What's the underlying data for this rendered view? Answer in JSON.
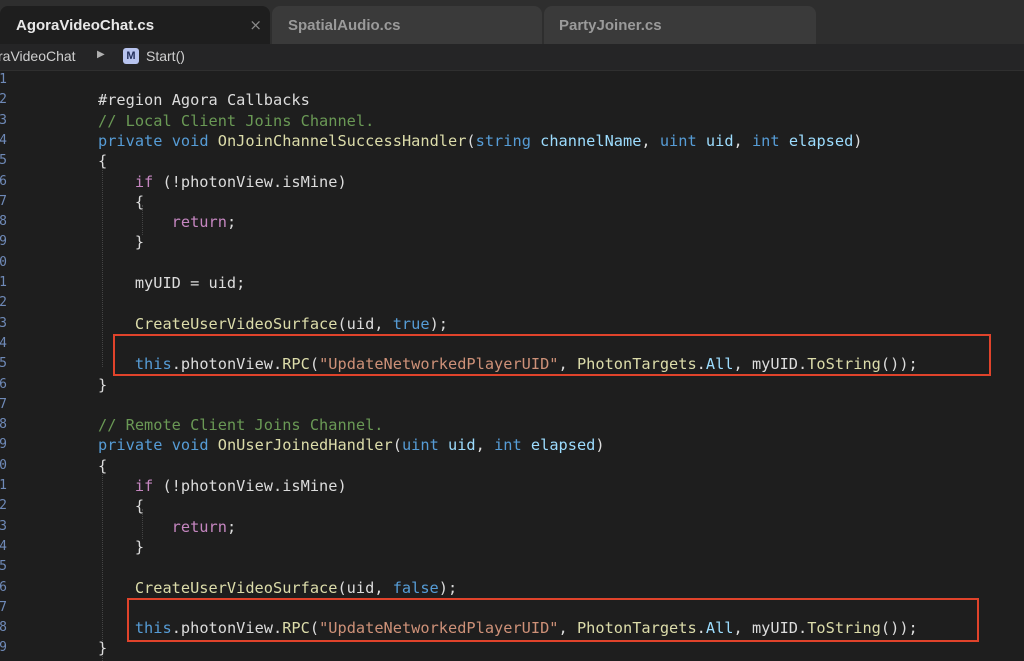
{
  "tabs": [
    {
      "label": "AgoraVideoChat.cs",
      "active": true,
      "close": "×"
    },
    {
      "label": "SpatialAudio.cs",
      "active": false
    },
    {
      "label": "PartyJoiner.cs",
      "active": false
    }
  ],
  "breadcrumb": {
    "class_name": "raVideoChat",
    "member_badge": "M",
    "method": "Start()"
  },
  "line_numbers": [
    "1",
    "2",
    "3",
    "4",
    "5",
    "6",
    "7",
    "8",
    "9",
    "0",
    "1",
    "2",
    "3",
    "4",
    "5",
    "6",
    "7",
    "8",
    "9",
    "0",
    "1",
    "2",
    "3",
    "4",
    "5",
    "6",
    "7",
    "8",
    "9"
  ],
  "code_lines": [
    [],
    [
      {
        "t": "#region ",
        "c": "pl"
      },
      {
        "t": "Agora Callbacks",
        "c": "pl"
      }
    ],
    [
      {
        "t": "// Local Client Joins Channel.",
        "c": "cm"
      }
    ],
    [
      {
        "t": "private ",
        "c": "kw"
      },
      {
        "t": "void ",
        "c": "kw"
      },
      {
        "t": "OnJoinChannelSuccessHandler",
        "c": "ty"
      },
      {
        "t": "(",
        "c": "pl"
      },
      {
        "t": "string ",
        "c": "kw"
      },
      {
        "t": "channelName",
        "c": "pr"
      },
      {
        "t": ", ",
        "c": "pl"
      },
      {
        "t": "uint ",
        "c": "kw"
      },
      {
        "t": "uid",
        "c": "pr"
      },
      {
        "t": ", ",
        "c": "pl"
      },
      {
        "t": "int ",
        "c": "kw"
      },
      {
        "t": "elapsed",
        "c": "pr"
      },
      {
        "t": ")",
        "c": "pl"
      }
    ],
    [
      {
        "t": "{",
        "c": "pl"
      }
    ],
    [
      {
        "t": "    if ",
        "c": "kwf"
      },
      {
        "t": "(!photonView.isMine)",
        "c": "pl"
      }
    ],
    [
      {
        "t": "    {",
        "c": "pl"
      }
    ],
    [
      {
        "t": "        return",
        "c": "kwf"
      },
      {
        "t": ";",
        "c": "pl"
      }
    ],
    [
      {
        "t": "    }",
        "c": "pl"
      }
    ],
    [],
    [
      {
        "t": "    myUID = uid;",
        "c": "pl"
      }
    ],
    [],
    [
      {
        "t": "    CreateUserVideoSurface",
        "c": "ty"
      },
      {
        "t": "(uid, ",
        "c": "pl"
      },
      {
        "t": "true",
        "c": "kw"
      },
      {
        "t": ");",
        "c": "pl"
      }
    ],
    [],
    [
      {
        "t": "    this",
        "c": "kw"
      },
      {
        "t": ".photonView.",
        "c": "pl"
      },
      {
        "t": "RPC",
        "c": "ty"
      },
      {
        "t": "(",
        "c": "pl"
      },
      {
        "t": "\"UpdateNetworkedPlayerUID\"",
        "c": "str"
      },
      {
        "t": ", ",
        "c": "pl"
      },
      {
        "t": "PhotonTargets",
        "c": "ty"
      },
      {
        "t": ".",
        "c": "pl"
      },
      {
        "t": "All",
        "c": "pr"
      },
      {
        "t": ", myUID.",
        "c": "pl"
      },
      {
        "t": "ToString",
        "c": "ty"
      },
      {
        "t": "());",
        "c": "pl"
      }
    ],
    [
      {
        "t": "}",
        "c": "pl"
      }
    ],
    [],
    [
      {
        "t": "// Remote Client Joins Channel.",
        "c": "cm"
      }
    ],
    [
      {
        "t": "private ",
        "c": "kw"
      },
      {
        "t": "void ",
        "c": "kw"
      },
      {
        "t": "OnUserJoinedHandler",
        "c": "ty"
      },
      {
        "t": "(",
        "c": "pl"
      },
      {
        "t": "uint ",
        "c": "kw"
      },
      {
        "t": "uid",
        "c": "pr"
      },
      {
        "t": ", ",
        "c": "pl"
      },
      {
        "t": "int ",
        "c": "kw"
      },
      {
        "t": "elapsed",
        "c": "pr"
      },
      {
        "t": ")",
        "c": "pl"
      }
    ],
    [
      {
        "t": "{",
        "c": "pl"
      }
    ],
    [
      {
        "t": "    if ",
        "c": "kwf"
      },
      {
        "t": "(!photonView.isMine)",
        "c": "pl"
      }
    ],
    [
      {
        "t": "    {",
        "c": "pl"
      }
    ],
    [
      {
        "t": "        return",
        "c": "kwf"
      },
      {
        "t": ";",
        "c": "pl"
      }
    ],
    [
      {
        "t": "    }",
        "c": "pl"
      }
    ],
    [],
    [
      {
        "t": "    CreateUserVideoSurface",
        "c": "ty"
      },
      {
        "t": "(uid, ",
        "c": "pl"
      },
      {
        "t": "false",
        "c": "kw"
      },
      {
        "t": ");",
        "c": "pl"
      }
    ],
    [],
    [
      {
        "t": "    this",
        "c": "kw"
      },
      {
        "t": ".photonView.",
        "c": "pl"
      },
      {
        "t": "RPC",
        "c": "ty"
      },
      {
        "t": "(",
        "c": "pl"
      },
      {
        "t": "\"UpdateNetworkedPlayerUID\"",
        "c": "str"
      },
      {
        "t": ", ",
        "c": "pl"
      },
      {
        "t": "PhotonTargets",
        "c": "ty"
      },
      {
        "t": ".",
        "c": "pl"
      },
      {
        "t": "All",
        "c": "pr"
      },
      {
        "t": ", myUID.",
        "c": "pl"
      },
      {
        "t": "ToString",
        "c": "ty"
      },
      {
        "t": "());",
        "c": "pl"
      }
    ],
    [
      {
        "t": "}",
        "c": "pl"
      }
    ]
  ],
  "colors": {
    "highlight_box": "#e0432b",
    "editor_bg": "#1e1e1e",
    "comment": "#6a9955",
    "keyword": "#569cd6",
    "string": "#ce9178"
  }
}
